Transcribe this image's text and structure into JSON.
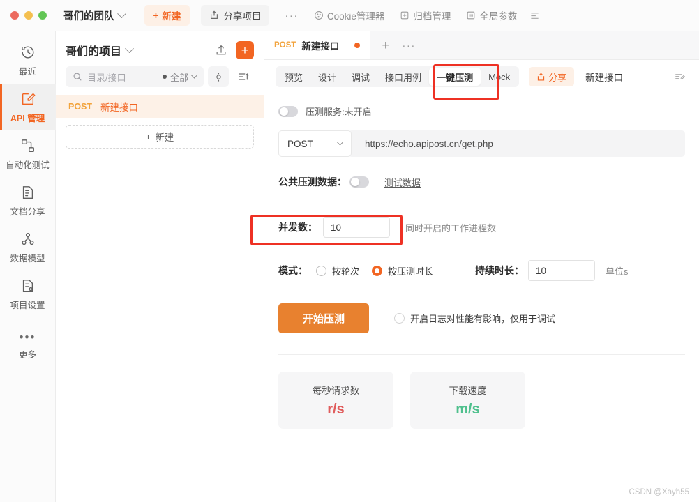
{
  "titlebar": {
    "team_name": "哥们的团队",
    "new_label": "新建",
    "share_project_label": "分享项目",
    "more_dots": "···",
    "cookie_label": "Cookie管理器",
    "archive_label": "归档管理",
    "global_params_label": "全局参数"
  },
  "sidebar": {
    "items": [
      {
        "label": "最近",
        "icon": "history-icon"
      },
      {
        "label": "API 管理",
        "icon": "api-edit-icon"
      },
      {
        "label": "自动化测试",
        "icon": "automation-icon"
      },
      {
        "label": "文档分享",
        "icon": "document-share-icon"
      },
      {
        "label": "数据模型",
        "icon": "data-model-icon"
      },
      {
        "label": "项目设置",
        "icon": "project-settings-icon"
      },
      {
        "label": "更多",
        "icon": "more-dots-icon"
      }
    ]
  },
  "project": {
    "title": "哥们的项目",
    "search_placeholder": "目录/接口",
    "filter_label": "全部",
    "api_item": {
      "method": "POST",
      "name": "新建接口"
    },
    "new_label": "新建"
  },
  "doc_tab": {
    "method": "POST",
    "name": "新建接口"
  },
  "subbar": {
    "tabs": [
      {
        "label": "预览"
      },
      {
        "label": "设计"
      },
      {
        "label": "调试"
      },
      {
        "label": "接口用例"
      },
      {
        "label": "一键压测"
      },
      {
        "label": "Mock"
      }
    ],
    "active_tab": "一键压测",
    "share_label": "分享",
    "api_name_value": "新建接口"
  },
  "stress": {
    "service_toggle_label": "压测服务:未开启",
    "service_toggle_on": false,
    "method": "POST",
    "url": "https://echo.apipost.cn/get.php",
    "public_data_label": "公共压测数据：",
    "public_data_on": false,
    "test_data_link": "测试数据",
    "concurrency_label": "并发数：",
    "concurrency_value": "10",
    "concurrency_hint": "同时开启的工作进程数",
    "mode_label": "模式：",
    "mode_options": [
      {
        "label": "按轮次",
        "selected": false
      },
      {
        "label": "按压测时长",
        "selected": true
      }
    ],
    "duration_label": "持续时长：",
    "duration_value": "10",
    "duration_unit": "单位s",
    "start_button": "开始压测",
    "log_option_label": "开启日志对性能有影响，仅用于调试",
    "log_option_checked": false,
    "cards": [
      {
        "title": "每秒请求数",
        "value": "r/s",
        "color": "#e05c5c"
      },
      {
        "title": "下载速度",
        "value": "m/s",
        "color": "#4fc08d"
      }
    ]
  },
  "colors": {
    "accent": "#f26522",
    "annotation": "#ee3124",
    "start_button": "#e8812f"
  },
  "watermark": "CSDN @Xayh55"
}
